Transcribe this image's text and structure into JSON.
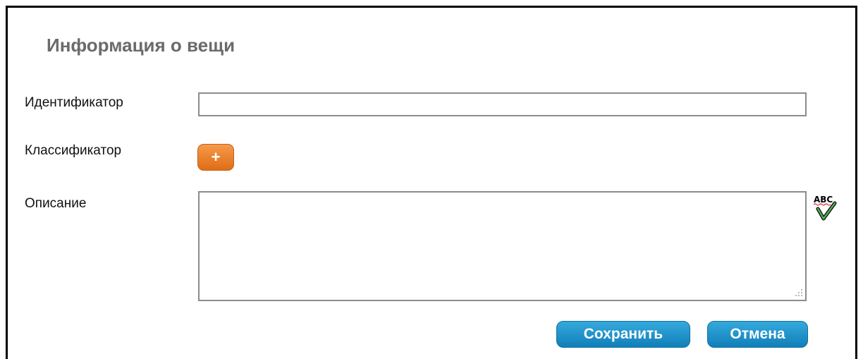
{
  "dialog": {
    "title": "Информация о вещи"
  },
  "form": {
    "identifier_label": "Идентификатор",
    "identifier_value": "",
    "classifier_label": "Классификатор",
    "classifier_add_label": "+",
    "description_label": "Описание",
    "description_value": "",
    "spellcheck_icon": "spellcheck-abc-icon",
    "spellcheck_text": "ABC"
  },
  "buttons": {
    "save_label": "Сохранить",
    "cancel_label": "Отмена"
  },
  "colors": {
    "accent_orange": "#e8781f",
    "accent_blue": "#1a8fc9",
    "title_gray": "#6b6b6b"
  }
}
